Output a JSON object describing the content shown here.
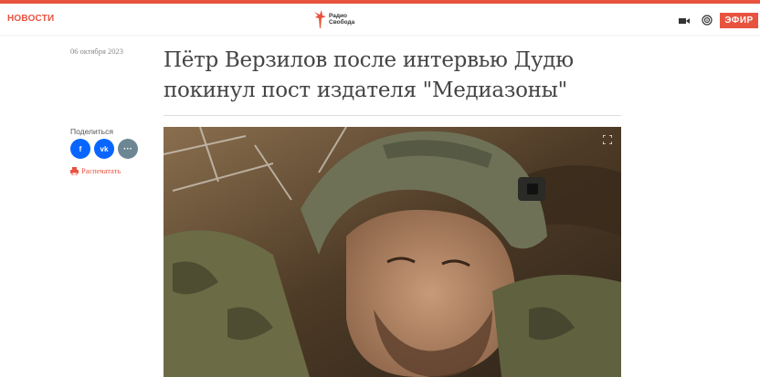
{
  "header": {
    "nav_label": "НОВОСТИ",
    "logo_line1": "Радио",
    "logo_line2": "Свобода",
    "live_label": "ЭФИР",
    "icons": [
      "video-icon",
      "radio-icon"
    ]
  },
  "article": {
    "date": "06 октября 2023",
    "title": "Пётр Верзилов после интервью Дудю покинул пост издателя \"Медиазоны\""
  },
  "share": {
    "label": "Поделиться",
    "buttons": [
      "f",
      "vk",
      "···"
    ],
    "print_label": "Распечатать"
  },
  "colors": {
    "accent": "#e8533f",
    "facebook": "#0866ff",
    "vk": "#0866ff",
    "more": "#6c8793"
  }
}
